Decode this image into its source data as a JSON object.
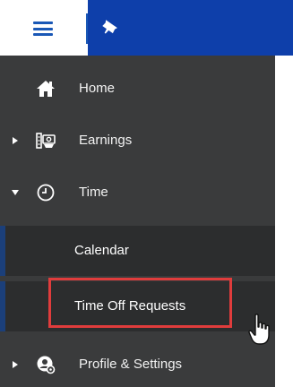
{
  "header": {
    "menu_icon": "hamburger-menu-icon",
    "pin_icon": "pin-icon",
    "accent_color": "#0e3faa"
  },
  "nav": {
    "items": [
      {
        "label": "Home",
        "icon": "home-icon",
        "expandable": false
      },
      {
        "label": "Earnings",
        "icon": "earnings-icon",
        "expandable": true,
        "expanded": false
      },
      {
        "label": "Time",
        "icon": "clock-icon",
        "expandable": true,
        "expanded": true
      },
      {
        "label": "Profile & Settings",
        "icon": "profile-settings-icon",
        "expandable": true,
        "expanded": false
      }
    ],
    "time_subitems": [
      {
        "label": "Calendar"
      },
      {
        "label": "Time Off Requests",
        "highlighted": true
      }
    ]
  },
  "colors": {
    "sidebar_bg": "#3a3b3c",
    "submenu_bg": "#2c2d2e",
    "highlight_border": "#e03c3c"
  }
}
